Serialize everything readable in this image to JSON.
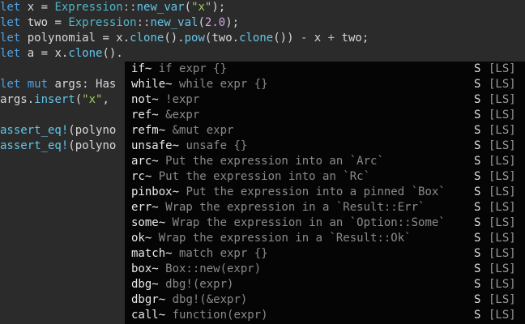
{
  "code_lines": [
    {
      "y": 0,
      "tokens": [
        {
          "t": "let",
          "c": "kw"
        },
        {
          "t": " x = ",
          "c": "plain"
        },
        {
          "t": "Expression",
          "c": "ty"
        },
        {
          "t": "::",
          "c": "op"
        },
        {
          "t": "new_var",
          "c": "fn"
        },
        {
          "t": "(",
          "c": "plain"
        },
        {
          "t": "\"x\"",
          "c": "str"
        },
        {
          "t": ");",
          "c": "plain"
        }
      ]
    },
    {
      "y": 1,
      "tokens": [
        {
          "t": "let",
          "c": "kw"
        },
        {
          "t": " two = ",
          "c": "plain"
        },
        {
          "t": "Expression",
          "c": "ty"
        },
        {
          "t": "::",
          "c": "op"
        },
        {
          "t": "new_val",
          "c": "fn"
        },
        {
          "t": "(",
          "c": "plain"
        },
        {
          "t": "2.0",
          "c": "num"
        },
        {
          "t": ");",
          "c": "plain"
        }
      ]
    },
    {
      "y": 2,
      "tokens": [
        {
          "t": "let",
          "c": "kw"
        },
        {
          "t": " polynomial = x.",
          "c": "plain"
        },
        {
          "t": "clone",
          "c": "fn"
        },
        {
          "t": "().",
          "c": "plain"
        },
        {
          "t": "pow",
          "c": "fn"
        },
        {
          "t": "(two.",
          "c": "plain"
        },
        {
          "t": "clone",
          "c": "fn"
        },
        {
          "t": "()) ",
          "c": "plain"
        },
        {
          "t": "-",
          "c": "op"
        },
        {
          "t": " x ",
          "c": "plain"
        },
        {
          "t": "+",
          "c": "op"
        },
        {
          "t": " two;",
          "c": "plain"
        }
      ]
    },
    {
      "y": 3,
      "tokens": [
        {
          "t": "let",
          "c": "kw"
        },
        {
          "t": " a = x.",
          "c": "plain"
        },
        {
          "t": "clone",
          "c": "fn"
        },
        {
          "t": "().",
          "c": "plain"
        }
      ]
    },
    {
      "y": 5,
      "tokens": [
        {
          "t": "let",
          "c": "kw"
        },
        {
          "t": " ",
          "c": "plain"
        },
        {
          "t": "mut",
          "c": "kw"
        },
        {
          "t": " args: Has",
          "c": "plain"
        }
      ]
    },
    {
      "y": 6,
      "tokens": [
        {
          "t": "args.",
          "c": "plain"
        },
        {
          "t": "insert",
          "c": "fn"
        },
        {
          "t": "(",
          "c": "plain"
        },
        {
          "t": "\"x\"",
          "c": "str"
        },
        {
          "t": ",",
          "c": "plain"
        }
      ]
    },
    {
      "y": 8,
      "tokens": [
        {
          "t": "assert_eq!",
          "c": "mac"
        },
        {
          "t": "(polyno",
          "c": "plain"
        }
      ]
    },
    {
      "y": 9,
      "tokens": [
        {
          "t": "assert_eq!",
          "c": "mac"
        },
        {
          "t": "(polyno",
          "c": "plain"
        }
      ]
    }
  ],
  "completion": {
    "items": [
      {
        "word": "if~",
        "desc": " if expr {}",
        "kind": "S",
        "source": "[LS]"
      },
      {
        "word": "while~",
        "desc": " while expr {}",
        "kind": "S",
        "source": "[LS]"
      },
      {
        "word": "not~",
        "desc": " !expr",
        "kind": "S",
        "source": "[LS]"
      },
      {
        "word": "ref~",
        "desc": " &expr",
        "kind": "S",
        "source": "[LS]"
      },
      {
        "word": "refm~",
        "desc": " &mut expr",
        "kind": "S",
        "source": "[LS]"
      },
      {
        "word": "unsafe~",
        "desc": " unsafe {}",
        "kind": "S",
        "source": "[LS]"
      },
      {
        "word": "arc~",
        "desc": " Put the expression into an `Arc`",
        "kind": "S",
        "source": "[LS]"
      },
      {
        "word": "rc~",
        "desc": " Put the expression into an `Rc`",
        "kind": "S",
        "source": "[LS]"
      },
      {
        "word": "pinbox~",
        "desc": " Put the expression into a pinned `Box`",
        "kind": "S",
        "source": "[LS]"
      },
      {
        "word": "err~",
        "desc": " Wrap the expression in a `Result::Err`",
        "kind": "S",
        "source": "[LS]"
      },
      {
        "word": "some~",
        "desc": " Wrap the expression in an `Option::Some`",
        "kind": "S",
        "source": "[LS]"
      },
      {
        "word": "ok~",
        "desc": " Wrap the expression in a `Result::Ok`",
        "kind": "S",
        "source": "[LS]"
      },
      {
        "word": "match~",
        "desc": " match expr {}",
        "kind": "S",
        "source": "[LS]"
      },
      {
        "word": "box~",
        "desc": " Box::new(expr)",
        "kind": "S",
        "source": "[LS]"
      },
      {
        "word": "dbg~",
        "desc": " dbg!(expr)",
        "kind": "S",
        "source": "[LS]"
      },
      {
        "word": "dbgr~",
        "desc": " dbg!(&expr)",
        "kind": "S",
        "source": "[LS]"
      },
      {
        "word": "call~",
        "desc": " function(expr)",
        "kind": "S",
        "source": "[LS]"
      }
    ]
  }
}
